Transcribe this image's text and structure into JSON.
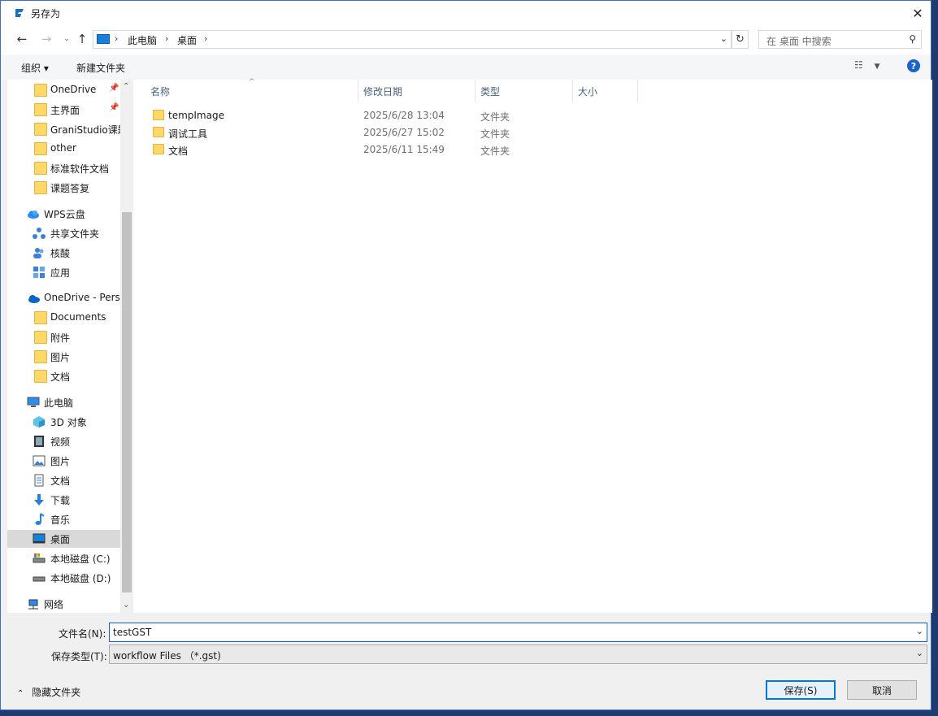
{
  "window": {
    "title": "另存为"
  },
  "address": {
    "crumbs": [
      "此电脑",
      "桌面"
    ]
  },
  "search": {
    "placeholder": "在 桌面 中搜索"
  },
  "toolbar": {
    "organize": "组织 ▾",
    "new_folder": "新建文件夹"
  },
  "sidebar": {
    "items": [
      {
        "label": "OneDrive",
        "icon": "folder-icon",
        "pinned": true
      },
      {
        "label": "主界面",
        "icon": "folder-icon",
        "pinned": true
      },
      {
        "label": "GraniStudio课题",
        "icon": "folder-icon"
      },
      {
        "label": "other",
        "icon": "folder-icon"
      },
      {
        "label": "标准软件文档",
        "icon": "folder-icon"
      },
      {
        "label": "课题答复",
        "icon": "folder-icon"
      },
      {
        "label": "WPS云盘",
        "icon": "cloud-icon"
      },
      {
        "label": "共享文件夹",
        "icon": "share-icon"
      },
      {
        "label": "核酸",
        "icon": "people-icon"
      },
      {
        "label": "应用",
        "icon": "apps-icon"
      },
      {
        "label": "OneDrive - Perso",
        "icon": "onedrive-icon"
      },
      {
        "label": "Documents",
        "icon": "folder-icon"
      },
      {
        "label": "附件",
        "icon": "folder-icon"
      },
      {
        "label": "图片",
        "icon": "folder-icon"
      },
      {
        "label": "文档",
        "icon": "folder-icon"
      },
      {
        "label": "此电脑",
        "icon": "computer-icon"
      },
      {
        "label": "3D 对象",
        "icon": "3d-objects-icon"
      },
      {
        "label": "视频",
        "icon": "video-icon"
      },
      {
        "label": "图片",
        "icon": "pictures-icon"
      },
      {
        "label": "文档",
        "icon": "documents-icon"
      },
      {
        "label": "下载",
        "icon": "download-icon"
      },
      {
        "label": "音乐",
        "icon": "music-icon"
      },
      {
        "label": "桌面",
        "icon": "desktop-icon",
        "selected": true
      },
      {
        "label": "本地磁盘 (C:)",
        "icon": "drive-c-icon"
      },
      {
        "label": "本地磁盘 (D:)",
        "icon": "drive-d-icon"
      },
      {
        "label": "网络",
        "icon": "network-icon"
      }
    ]
  },
  "columns": {
    "name": "名称",
    "modified": "修改日期",
    "type": "类型",
    "size": "大小"
  },
  "files": [
    {
      "name": "tempImage",
      "modified": "2025/6/28 13:04",
      "type": "文件夹"
    },
    {
      "name": "调试工具",
      "modified": "2025/6/27 15:02",
      "type": "文件夹"
    },
    {
      "name": "文档",
      "modified": "2025/6/11 15:49",
      "type": "文件夹"
    }
  ],
  "form": {
    "filename_label": "文件名(N):",
    "filename_value": "testGST",
    "filetype_label": "保存类型(T):",
    "filetype_value": "workflow Files （*.gst)"
  },
  "footer": {
    "hide_folders": "隐藏文件夹",
    "save": "保存(S)",
    "cancel": "取消"
  },
  "colors": {
    "accent": "#0078d7",
    "folder": "#ffd868",
    "selected_row": "#d9d9d9"
  }
}
